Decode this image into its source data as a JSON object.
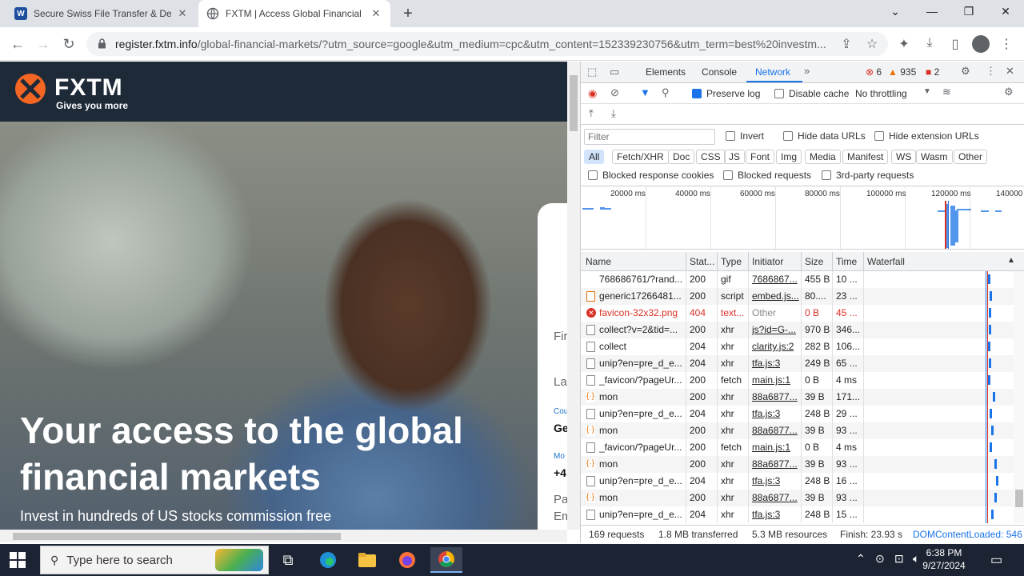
{
  "browser": {
    "tabs": [
      {
        "title": "Secure Swiss File Transfer & Dec",
        "favicon": "W",
        "favicon_color": "#1e4e9c",
        "active": false
      },
      {
        "title": "FXTM | Access Global Financial M",
        "favicon": "globe-icon",
        "active": true
      }
    ],
    "url_domain": "register.fxtm.info",
    "url_path": "/global-financial-markets/?utm_source=google&utm_medium=cpc&utm_content=152339230756&utm_term=best%20investm..."
  },
  "page": {
    "logo_text": "FXTM",
    "logo_tagline": "Gives you more",
    "headline": "Your access to the global financial markets",
    "subline": "Invest in hundreds of US stocks commission free",
    "form_labels": [
      "Fir",
      "La",
      "Cou",
      "Ge",
      "Mo",
      "+4",
      "Em",
      "Pa"
    ]
  },
  "devtools": {
    "tabs": [
      "Elements",
      "Console",
      "Network"
    ],
    "active_tab": "Network",
    "errors": "6",
    "warnings": "935",
    "issues": "2",
    "preserve_log_label": "Preserve log",
    "disable_cache_label": "Disable cache",
    "throttling": "No throttling",
    "filter_placeholder": "Filter",
    "invert_label": "Invert",
    "hide_data_urls_label": "Hide data URLs",
    "hide_extension_urls_label": "Hide extension URLs",
    "type_filters": [
      "All",
      "Fetch/XHR",
      "Doc",
      "CSS",
      "JS",
      "Font",
      "Img",
      "Media",
      "Manifest",
      "WS",
      "Wasm",
      "Other"
    ],
    "blocked_cookies_label": "Blocked response cookies",
    "blocked_requests_label": "Blocked requests",
    "third_party_label": "3rd-party requests",
    "overview_ticks": [
      "20000 ms",
      "40000 ms",
      "60000 ms",
      "80000 ms",
      "100000 ms",
      "120000 ms",
      "140000"
    ],
    "columns": [
      "Name",
      "Stat...",
      "Type",
      "Initiator",
      "Size",
      "Time",
      "Waterfall"
    ],
    "requests": [
      {
        "icon": "gif",
        "name": "768686761/?rand...",
        "status": "200",
        "type": "gif",
        "initiator": "7686867...",
        "size": "455 B",
        "time": "10 ..."
      },
      {
        "icon": "script",
        "name": "generic17266481...",
        "status": "200",
        "type": "script",
        "initiator": "embed.js...",
        "size": "80....",
        "time": "23 ..."
      },
      {
        "icon": "error",
        "name": "favicon-32x32.png",
        "status": "404",
        "type": "text...",
        "initiator": "Other",
        "size": "0 B",
        "time": "45 ..."
      },
      {
        "icon": "doc",
        "name": "collect?v=2&tid=...",
        "status": "200",
        "type": "xhr",
        "initiator": "js?id=G-...",
        "size": "970 B",
        "time": "346..."
      },
      {
        "icon": "doc",
        "name": "collect",
        "status": "204",
        "type": "xhr",
        "initiator": "clarity.js:2",
        "size": "282 B",
        "time": "106..."
      },
      {
        "icon": "doc",
        "name": "unip?en=pre_d_e...",
        "status": "204",
        "type": "xhr",
        "initiator": "tfa.js:3",
        "size": "249 B",
        "time": "65 ..."
      },
      {
        "icon": "fetch",
        "name": "_favicon/?pageUr...",
        "status": "200",
        "type": "fetch",
        "initiator": "main.js:1",
        "size": "0 B",
        "time": "4 ms"
      },
      {
        "icon": "mon",
        "name": "mon",
        "status": "200",
        "type": "xhr",
        "initiator": "88a6877...",
        "size": "39 B",
        "time": "171..."
      },
      {
        "icon": "doc",
        "name": "unip?en=pre_d_e...",
        "status": "204",
        "type": "xhr",
        "initiator": "tfa.js:3",
        "size": "248 B",
        "time": "29 ..."
      },
      {
        "icon": "mon",
        "name": "mon",
        "status": "200",
        "type": "xhr",
        "initiator": "88a6877...",
        "size": "39 B",
        "time": "93 ..."
      },
      {
        "icon": "fetch",
        "name": "_favicon/?pageUr...",
        "status": "200",
        "type": "fetch",
        "initiator": "main.js:1",
        "size": "0 B",
        "time": "4 ms"
      },
      {
        "icon": "mon",
        "name": "mon",
        "status": "200",
        "type": "xhr",
        "initiator": "88a6877...",
        "size": "39 B",
        "time": "93 ..."
      },
      {
        "icon": "doc",
        "name": "unip?en=pre_d_e...",
        "status": "204",
        "type": "xhr",
        "initiator": "tfa.js:3",
        "size": "248 B",
        "time": "16 ..."
      },
      {
        "icon": "mon",
        "name": "mon",
        "status": "200",
        "type": "xhr",
        "initiator": "88a6877...",
        "size": "39 B",
        "time": "93 ..."
      },
      {
        "icon": "doc",
        "name": "unip?en=pre_d_e...",
        "status": "204",
        "type": "xhr",
        "initiator": "tfa.js:3",
        "size": "248 B",
        "time": "15 ..."
      }
    ],
    "status": {
      "requests": "169 requests",
      "transferred": "1.8 MB transferred",
      "resources": "5.3 MB resources",
      "finish": "Finish: 23.93 s",
      "dcl": "DOMContentLoaded: 546"
    }
  },
  "taskbar": {
    "search_placeholder": "Type here to search",
    "time": "6:38 PM",
    "date": "9/27/2024"
  },
  "colors": {
    "fxtm_orange": "#f26522",
    "fxtm_navy": "#1e2a38",
    "devtools_blue": "#1a73e8",
    "error_red": "#d93025"
  }
}
